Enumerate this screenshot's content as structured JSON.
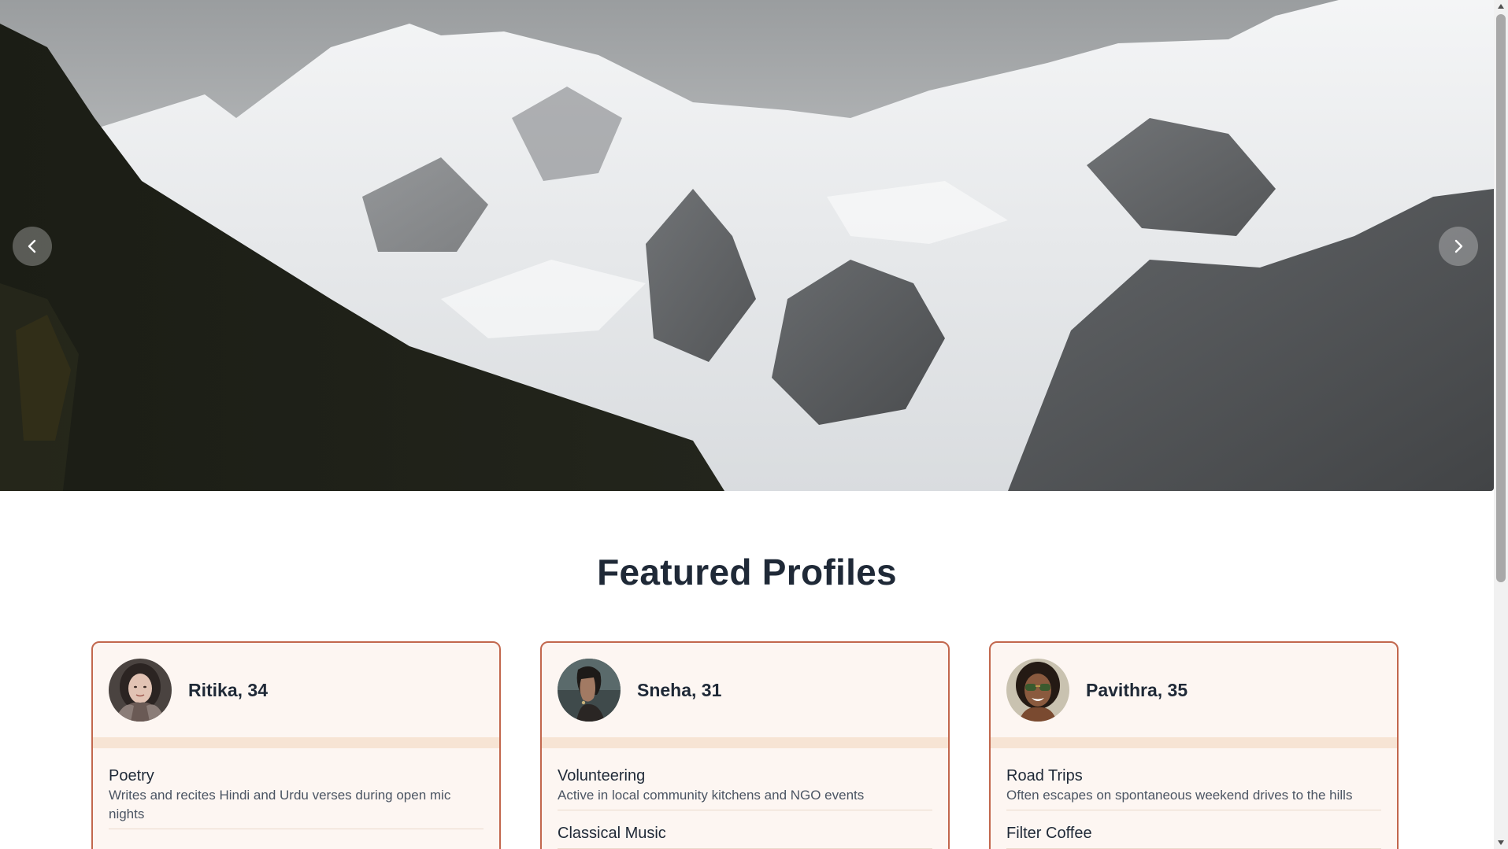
{
  "hero": {
    "prev_icon": "chevron-left-icon",
    "next_icon": "chevron-right-icon",
    "image": "snowy-mountain-landscape"
  },
  "featured": {
    "title": "Featured Profiles"
  },
  "profiles": [
    {
      "name": "Ritika, 34",
      "avatar": "woman-headscarf-avatar",
      "interests": [
        {
          "title": "Poetry",
          "desc": "Writes and recites Hindi and Urdu verses during open mic nights"
        }
      ]
    },
    {
      "name": "Sneha, 31",
      "avatar": "woman-profile-avatar",
      "interests": [
        {
          "title": "Volunteering",
          "desc": "Active in local community kitchens and NGO events"
        },
        {
          "title": "Classical Music",
          "desc": ""
        }
      ]
    },
    {
      "name": "Pavithra, 35",
      "avatar": "woman-sunglasses-avatar",
      "interests": [
        {
          "title": "Road Trips",
          "desc": "Often escapes on spontaneous weekend drives to the hills"
        },
        {
          "title": "Filter Coffee",
          "desc": ""
        }
      ]
    }
  ],
  "colors": {
    "card_border": "#c2674d",
    "card_bg": "#fdf6f2",
    "card_band": "#f7e4d4",
    "heading": "#1f2937"
  }
}
